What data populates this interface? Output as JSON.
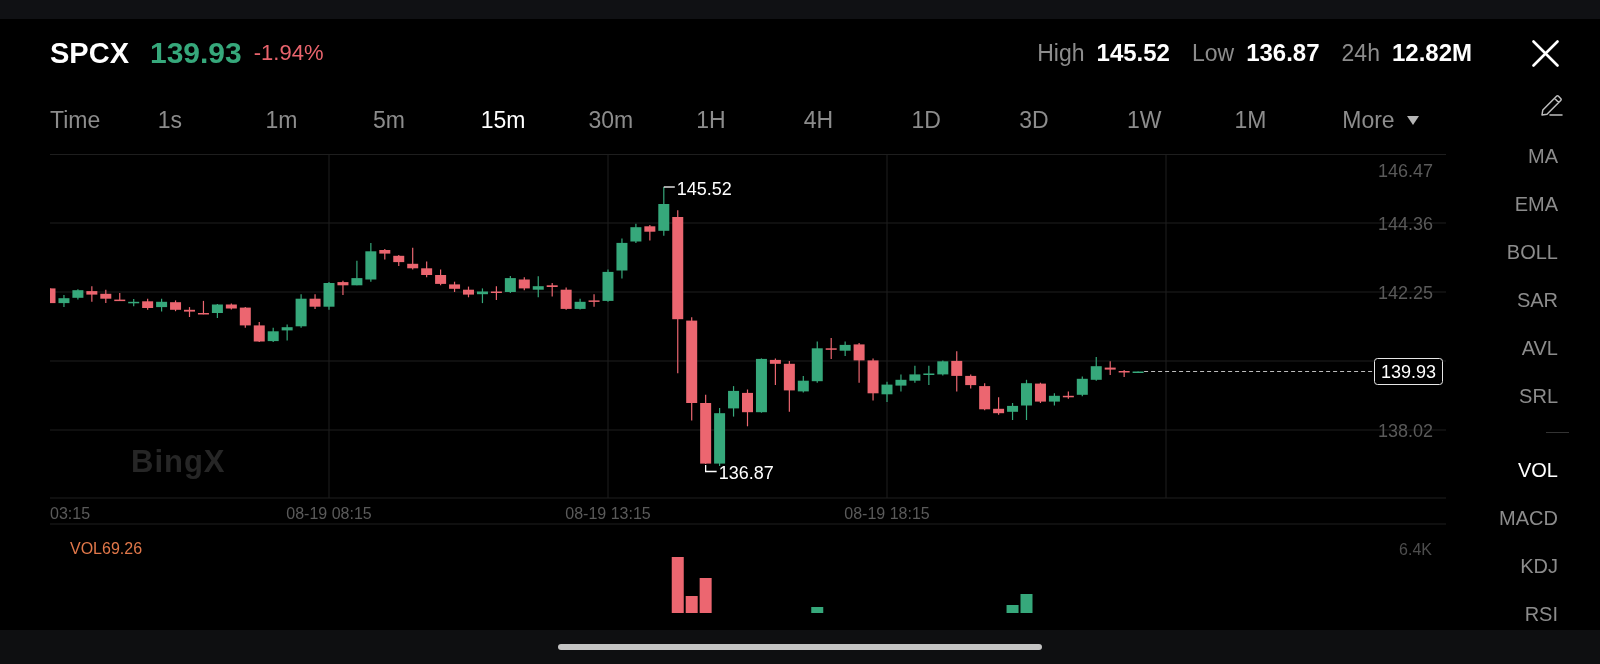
{
  "header": {
    "symbol": "SPCX",
    "price": "139.93",
    "change": "-1.94%",
    "stats": [
      {
        "label": "High",
        "value": "145.52"
      },
      {
        "label": "Low",
        "value": "136.87"
      },
      {
        "label": "24h",
        "value": "12.82M"
      }
    ]
  },
  "intervals": [
    {
      "label": "Time",
      "kind": "tab",
      "selected": false
    },
    {
      "label": "1s",
      "kind": "tab",
      "selected": false
    },
    {
      "label": "1m",
      "kind": "tab",
      "selected": false
    },
    {
      "label": "5m",
      "kind": "tab",
      "selected": false
    },
    {
      "label": "15m",
      "kind": "tab",
      "selected": true
    },
    {
      "label": "30m",
      "kind": "tab",
      "selected": false
    },
    {
      "label": "1H",
      "kind": "tab",
      "selected": false
    },
    {
      "label": "4H",
      "kind": "tab",
      "selected": false
    },
    {
      "label": "1D",
      "kind": "tab",
      "selected": false
    },
    {
      "label": "3D",
      "kind": "tab",
      "selected": false
    },
    {
      "label": "1W",
      "kind": "tab",
      "selected": false
    },
    {
      "label": "1M",
      "kind": "tab",
      "selected": false
    },
    {
      "label": "More",
      "kind": "dropdown",
      "selected": false
    }
  ],
  "chart": {
    "watermark": "BingX",
    "price_axis": [
      "146.47",
      "144.36",
      "142.25",
      "138.02"
    ],
    "time_axis": [
      "03:15",
      "08-19 08:15",
      "08-19 13:15",
      "08-19 18:15"
    ],
    "high_label": "145.52",
    "low_label": "136.87",
    "last_price": "139.93"
  },
  "volume": {
    "label": "VOL69.26",
    "axis_max": "6.4K"
  },
  "main_indicators": [
    {
      "label": "MA",
      "selected": false
    },
    {
      "label": "EMA",
      "selected": false
    },
    {
      "label": "BOLL",
      "selected": false
    },
    {
      "label": "SAR",
      "selected": false
    },
    {
      "label": "AVL",
      "selected": false
    },
    {
      "label": "SRL",
      "selected": false
    }
  ],
  "sub_indicators": [
    {
      "label": "VOL",
      "selected": true
    },
    {
      "label": "MACD",
      "selected": false
    },
    {
      "label": "KDJ",
      "selected": false
    },
    {
      "label": "RSI",
      "selected": false
    }
  ]
}
